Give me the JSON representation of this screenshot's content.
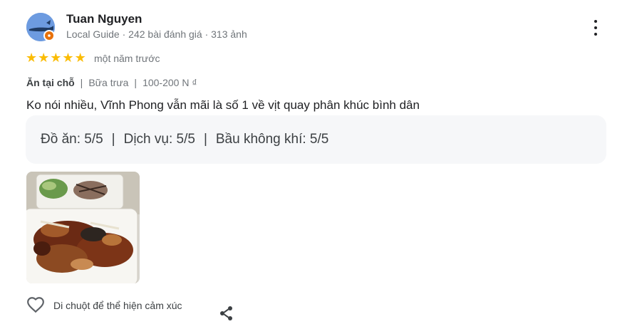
{
  "reviewer": {
    "name": "Tuan Nguyen",
    "meta": "Local Guide · 242 bài đánh giá · 313 ảnh",
    "avatar_icon": "whale-avatar-icon",
    "badge_icon": "local-guide-badge-icon"
  },
  "rating": {
    "stars": 5,
    "max": 5,
    "time": "một năm trước",
    "star_color": "#fbbc04"
  },
  "attributes": {
    "service_type": "Ăn tại chỗ",
    "meal": "Bữa trưa",
    "price": "100-200 N ₫"
  },
  "review_text": "Ko nói nhiều, Vĩnh Phong vẫn mãi là số 1 về vịt quay phân khúc bình dân",
  "sub_ratings": [
    {
      "label": "Đồ ăn: 5/5"
    },
    {
      "label": "Dịch vụ: 5/5"
    },
    {
      "label": "Bầu không khí: 5/5"
    }
  ],
  "photo": {
    "icon": "roast-duck-photo"
  },
  "actions": {
    "like_label": "Di chuột để thể hiện cảm xúc",
    "like_icon": "heart-icon",
    "share_icon": "share-icon",
    "more_icon": "more-vert-icon"
  }
}
